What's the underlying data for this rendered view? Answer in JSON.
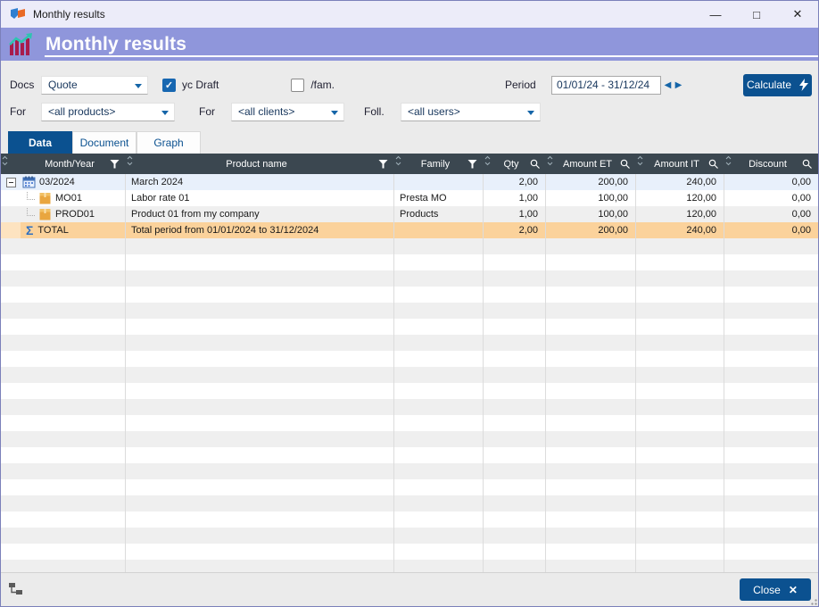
{
  "window": {
    "title": "Monthly results"
  },
  "banner": {
    "title": "Monthly results"
  },
  "filters": {
    "docs_label": "Docs",
    "docs_value": "Quote",
    "yc_draft_label": "yc Draft",
    "fam_label": "/fam.",
    "period_label": "Period",
    "period_value": "01/01/24 - 31/12/24",
    "calculate_label": "Calculate",
    "for_products_label": "For",
    "products_value": "<all products>",
    "for_clients_label": "For",
    "clients_value": "<all clients>",
    "foll_label": "Foll.",
    "users_value": "<all users>"
  },
  "tabs": [
    {
      "label": "Data",
      "active": true
    },
    {
      "label": "Document",
      "active": false
    },
    {
      "label": "Graph",
      "active": false
    }
  ],
  "table": {
    "columns": [
      {
        "label": "Month/Year",
        "icon": "filter"
      },
      {
        "label": "Product name",
        "icon": "filter"
      },
      {
        "label": "Family",
        "icon": "filter"
      },
      {
        "label": "Qty",
        "icon": "search"
      },
      {
        "label": "Amount ET",
        "icon": "search"
      },
      {
        "label": "Amount IT",
        "icon": "search"
      },
      {
        "label": "Discount",
        "icon": "search"
      }
    ],
    "rows": [
      {
        "type": "month",
        "id": "03/2024",
        "product": "March 2024",
        "family": "",
        "qty": "2,00",
        "amount_et": "200,00",
        "amount_it": "240,00",
        "discount": "0,00"
      },
      {
        "type": "item",
        "id": "MO01",
        "product": "Labor rate 01",
        "family": "Presta MO",
        "qty": "1,00",
        "amount_et": "100,00",
        "amount_it": "120,00",
        "discount": "0,00"
      },
      {
        "type": "item",
        "id": "PROD01",
        "product": "Product 01 from my company",
        "family": "Products",
        "qty": "1,00",
        "amount_et": "100,00",
        "amount_it": "120,00",
        "discount": "0,00"
      },
      {
        "type": "total",
        "id": "TOTAL",
        "product": "Total period from 01/01/2024 to 31/12/2024",
        "family": "",
        "qty": "2,00",
        "amount_et": "200,00",
        "amount_it": "240,00",
        "discount": "0,00"
      }
    ],
    "empty_row_count": 21
  },
  "footer": {
    "close_label": "Close"
  },
  "colors": {
    "banner_bg": "#8f96db",
    "titlebar_bg": "#ececf9",
    "header_bg": "#3b4750",
    "accent_blue": "#0b5190",
    "combo_arrow_blue": "#1565a8",
    "month_row_bg": "#e8f0fb",
    "total_row_bg": "#fbd29b",
    "alt_row_bg": "#efefef"
  }
}
